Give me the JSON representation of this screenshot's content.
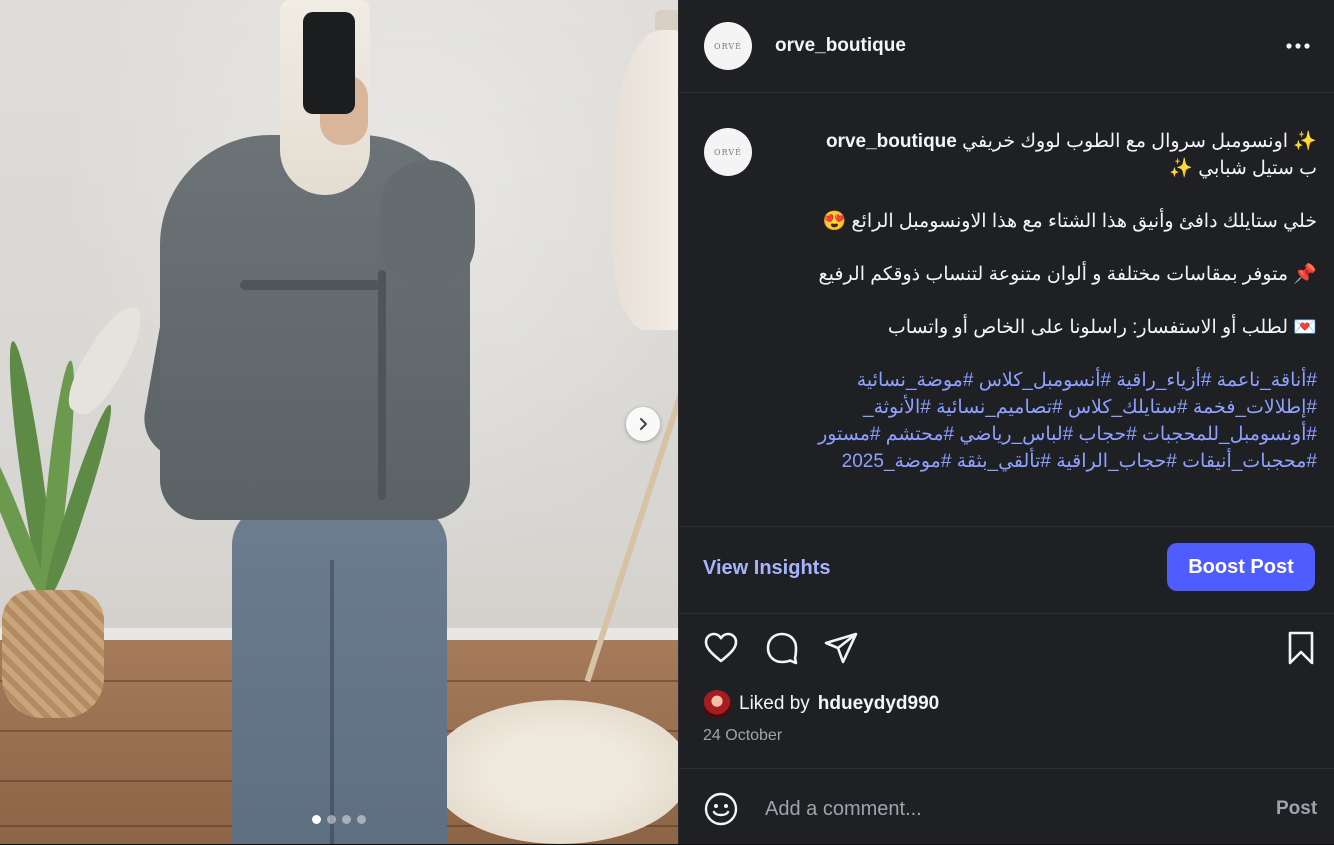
{
  "post": {
    "username": "orve_boutique",
    "avatar_text": "ORVÉ",
    "more_icon": "more-horizontal-icon"
  },
  "caption": {
    "line1_prefix": "✨ اونسومبل سروال مع الطوب لووك خريفي",
    "line1_suffix": "ب ستيل شبابي ✨",
    "para2": "خلي ستايلك دافئ وأنيق هذا الشتاء مع هذا الاونسومبل الرائع 😍",
    "para3": "📌 متوفر بمقاسات مختلفة و ألوان متنوعة لتنساب ذوقكم الرفيع",
    "para4": "💌 لطلب أو الاستفسار: راسلونا على الخاص أو واتساب",
    "hashtags": "#أناقة_ناعمة #أزياء_راقية #أنسومبل_كلاس #موضة_نسائية #إطلالات_فخمة #ستايلك_كلاس #تصاميم_نسائية #الأنوثة_ #أونسومبل_للمحجبات #حجاب #لباس_رياضي #محتشم #مستور #محجبات_أنيقات #حجاب_الراقية #تألقي_بثقة #موضة_2025"
  },
  "insights": {
    "view_label": "View Insights",
    "boost_label": "Boost Post"
  },
  "likes": {
    "prefix": "Liked by",
    "user": "hdueydyd990",
    "date": "24 October"
  },
  "comment": {
    "placeholder": "Add a comment...",
    "post_label": "Post"
  },
  "carousel": {
    "slides": 4,
    "active_index": 0
  },
  "colors": {
    "panel_bg": "#1f2024",
    "accent": "#4f5dff",
    "link": "#a5b4fc",
    "hashtag": "#8ea1ff"
  }
}
